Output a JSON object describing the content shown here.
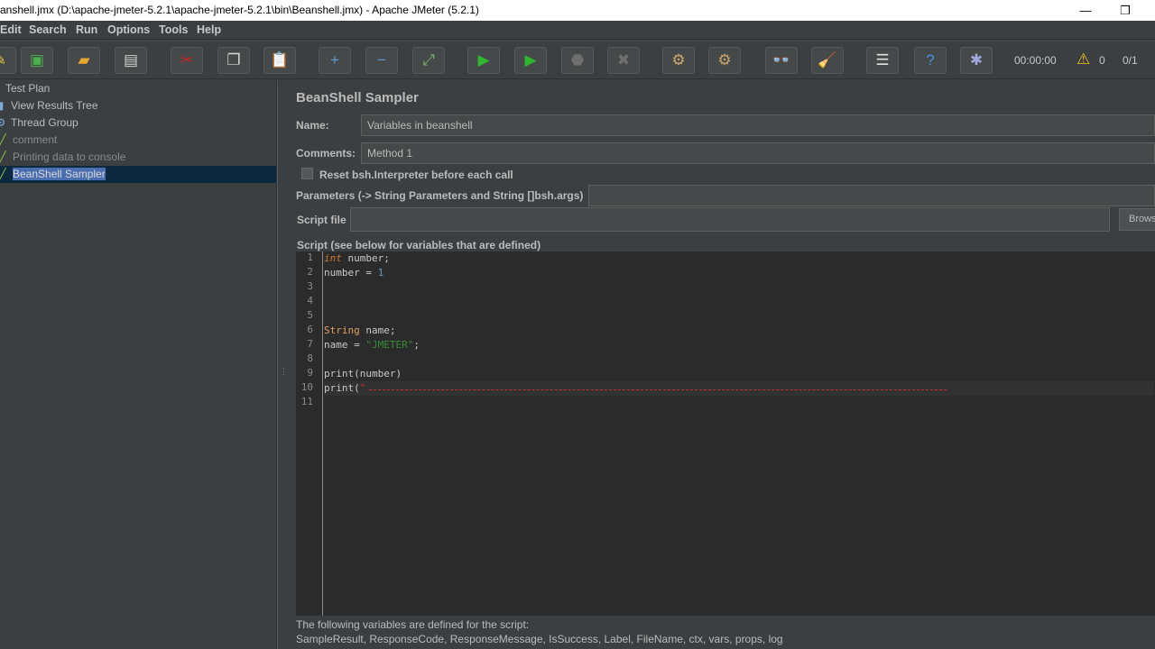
{
  "window": {
    "title": "anshell.jmx (D:\\apache-jmeter-5.2.1\\apache-jmeter-5.2.1\\bin\\Beanshell.jmx) - Apache JMeter (5.2.1)",
    "minimize": "—",
    "restore": "❐"
  },
  "menu": [
    "Edit",
    "Search",
    "Run",
    "Options",
    "Tools",
    "Help"
  ],
  "toolbar": {
    "timer": "00:00:00",
    "warnings": "0",
    "threads": "0/1",
    "buttons": [
      {
        "name": "new-icon",
        "glyph": "✎",
        "color": "#e0c040"
      },
      {
        "name": "templates-icon",
        "glyph": "▣",
        "color": "#4caf50"
      },
      {
        "name": "open-icon",
        "glyph": "▰",
        "color": "#e8a531"
      },
      {
        "name": "save-icon",
        "glyph": "▤",
        "color": "#cfcfcf"
      },
      {
        "name": "cut-icon",
        "glyph": "✂",
        "color": "#d02020"
      },
      {
        "name": "copy-icon",
        "glyph": "❐",
        "color": "#d8d8d8"
      },
      {
        "name": "paste-icon",
        "glyph": "📋",
        "color": "#e0b060"
      },
      {
        "name": "expand-icon",
        "glyph": "+",
        "color": "#5b9bd5"
      },
      {
        "name": "collapse-icon",
        "glyph": "−",
        "color": "#5b9bd5"
      },
      {
        "name": "toggle-icon",
        "glyph": "⤢",
        "color": "#7fb36b"
      },
      {
        "name": "start-icon",
        "glyph": "▶",
        "color": "#2fb52f"
      },
      {
        "name": "start-no-pauses-icon",
        "glyph": "▶",
        "color": "#2fb52f"
      },
      {
        "name": "stop-icon",
        "glyph": "⬣",
        "color": "#6e6e6e"
      },
      {
        "name": "shutdown-icon",
        "glyph": "✖",
        "color": "#6e6e6e"
      },
      {
        "name": "clear-icon",
        "glyph": "⚙",
        "color": "#c9a56b"
      },
      {
        "name": "clear-all-icon",
        "glyph": "⚙",
        "color": "#c9a56b"
      },
      {
        "name": "search-icon",
        "glyph": "👓",
        "color": "#bbbbbb"
      },
      {
        "name": "reset-search-icon",
        "glyph": "🧹",
        "color": "#f0d030"
      },
      {
        "name": "function-helper-icon",
        "glyph": "☰",
        "color": "#e0e0e0"
      },
      {
        "name": "help-icon",
        "glyph": "?",
        "color": "#4a90e2"
      },
      {
        "name": "remote-icon",
        "glyph": "✱",
        "color": "#9fa8da"
      }
    ]
  },
  "tree": [
    {
      "label": "Test Plan",
      "icon": "",
      "indent": 0,
      "dim": false
    },
    {
      "label": "View Results Tree",
      "icon": "▮",
      "indent": 1,
      "dim": false
    },
    {
      "label": "Thread Group",
      "icon": "⚙",
      "indent": 1,
      "dim": false
    },
    {
      "label": "comment",
      "icon": "╱",
      "indent": 2,
      "dim": true
    },
    {
      "label": "Printing data to console",
      "icon": "╱",
      "indent": 2,
      "dim": true
    },
    {
      "label": "BeanShell Sampler",
      "icon": "╱",
      "indent": 2,
      "dim": false,
      "selected": true
    }
  ],
  "sampler": {
    "title": "BeanShell Sampler",
    "name_label": "Name:",
    "name_value": "Variables in beanshell",
    "comments_label": "Comments:",
    "comments_value": "Method 1",
    "reset_label": "Reset bsh.Interpreter before each call",
    "parameters_label": "Parameters (-> String Parameters and String []bsh.args)",
    "script_file_label": "Script file",
    "browse": "Browse",
    "script_label": "Script (see below for variables that are defined)",
    "footer1": "The following variables are defined for the script:",
    "footer2": "SampleResult, ResponseCode, ResponseMessage, IsSuccess, Label, FileName, ctx, vars, props, log"
  },
  "script_lines": [
    "int number;",
    "number = 1",
    "",
    "",
    "",
    "String name;",
    "name = \"JMETER\";",
    "",
    "print(number)",
    "print(\"",
    ""
  ]
}
